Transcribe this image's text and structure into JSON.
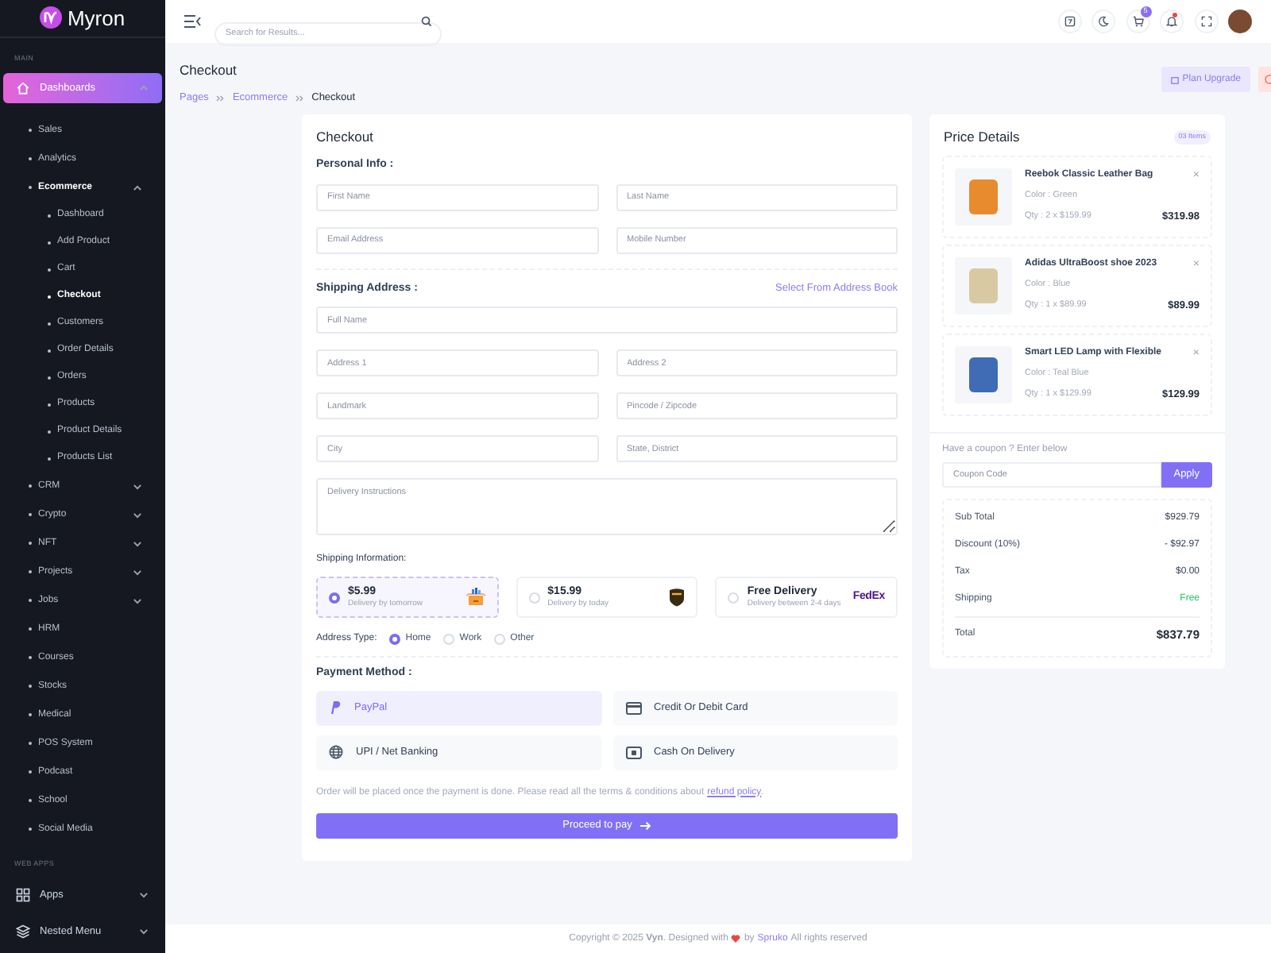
{
  "brand": {
    "name": "Myron"
  },
  "sidebar": {
    "sections": [
      {
        "label": "MAIN",
        "items": [
          {
            "label": "Dashboards",
            "expanded": true,
            "selected": true,
            "children": [
              {
                "label": "Sales",
                "selected": false
              },
              {
                "label": "Analytics",
                "selected": false
              },
              {
                "label": "Ecommerce",
                "selected": false,
                "expanded": true,
                "children": [
                  {
                    "label": "Dashboard",
                    "selected": false
                  },
                  {
                    "label": "Add Product",
                    "selected": false
                  },
                  {
                    "label": "Cart",
                    "selected": false
                  },
                  {
                    "label": "Checkout",
                    "selected": true
                  },
                  {
                    "label": "Customers",
                    "selected": false
                  },
                  {
                    "label": "Order Details",
                    "selected": false
                  },
                  {
                    "label": "Orders",
                    "selected": false
                  },
                  {
                    "label": "Products",
                    "selected": false
                  },
                  {
                    "label": "Product Details",
                    "selected": false
                  },
                  {
                    "label": "Products List",
                    "selected": false
                  }
                ]
              },
              {
                "label": "CRM",
                "selected": false,
                "expanded": false
              },
              {
                "label": "Crypto",
                "selected": false,
                "expanded": false
              },
              {
                "label": "NFT",
                "selected": false,
                "expanded": false
              },
              {
                "label": "Projects",
                "selected": false,
                "expanded": false
              },
              {
                "label": "Jobs",
                "selected": false,
                "expanded": false
              },
              {
                "label": "HRM",
                "selected": false
              },
              {
                "label": "Courses",
                "selected": false
              },
              {
                "label": "Stocks",
                "selected": false
              },
              {
                "label": "Medical",
                "selected": false
              },
              {
                "label": "POS System",
                "selected": false
              },
              {
                "label": "Podcast",
                "selected": false
              },
              {
                "label": "School",
                "selected": false
              },
              {
                "label": "Social Media",
                "selected": false
              }
            ]
          }
        ]
      },
      {
        "label": "WEB APPS",
        "items": [
          {
            "label": "Apps",
            "expanded": false,
            "selected": false
          },
          {
            "label": "Nested Menu",
            "expanded": false,
            "selected": false
          }
        ]
      }
    ]
  },
  "header": {
    "search": {
      "placeholder": "Search for Results..."
    },
    "cart_badge": "5",
    "notifications_unread": true
  },
  "page": {
    "title": "Checkout",
    "breadcrumb": [
      "Pages",
      "Ecommerce",
      "Checkout"
    ],
    "actions": [
      {
        "label": "Plan Upgrade",
        "kind": "upgrade"
      },
      {
        "kind": "danger-icon"
      }
    ]
  },
  "checkout": {
    "title": "Checkout",
    "personal": {
      "heading": "Personal Info :",
      "fields": [
        {
          "placeholder": "First Name"
        },
        {
          "placeholder": "Last Name"
        },
        {
          "placeholder": "Email Address"
        },
        {
          "placeholder": "Mobile Number"
        }
      ]
    },
    "shipping_address": {
      "heading": "Shipping Address :",
      "link": "Select From Address Book",
      "fields": [
        {
          "placeholder": "Full Name",
          "kind": "wide"
        },
        {
          "placeholder": "Address 1",
          "kind": "half"
        },
        {
          "placeholder": "Address 2",
          "kind": "half"
        },
        {
          "placeholder": "Landmark",
          "kind": "half"
        },
        {
          "placeholder": "Pincode / Zipcode",
          "kind": "half"
        },
        {
          "placeholder": "City",
          "kind": "half"
        },
        {
          "placeholder": "State, District",
          "kind": "half"
        },
        {
          "placeholder": "Delivery Instructions",
          "kind": "textarea"
        }
      ]
    },
    "shipping_info": {
      "label": "Shipping Information:",
      "options": [
        {
          "price": "$5.99",
          "note": "Delivery by tomorrow",
          "selected": true
        },
        {
          "price": "$15.99",
          "note": "Delivery by today",
          "selected": false
        },
        {
          "price": "Free Delivery",
          "note": "Delivery between 2-4 days",
          "logo_text": "FedEx",
          "selected": false
        }
      ]
    },
    "address_type": {
      "label": "Address Type:",
      "options": [
        {
          "label": "Home",
          "selected": true
        },
        {
          "label": "Work",
          "selected": false
        },
        {
          "label": "Other",
          "selected": false
        }
      ]
    },
    "payment": {
      "heading": "Payment Method :",
      "methods": [
        {
          "label": "PayPal",
          "selected": true
        },
        {
          "label": "Credit Or Debit Card",
          "selected": false
        },
        {
          "label": "UPI / Net Banking",
          "selected": false
        },
        {
          "label": "Cash On Delivery",
          "selected": false
        }
      ]
    },
    "note": "Order will be placed once the payment is done. Please read all the terms & conditions about",
    "note_link": "refund policy",
    "note_end": ".",
    "submit": "Proceed to pay"
  },
  "price_details": {
    "title": "Price Details",
    "count": "03 Items",
    "items": [
      {
        "name": "Reebok Classic Leather Bag",
        "variant": "Color : Green",
        "qty": "Qty : 2 x $159.99",
        "price": "$319.98",
        "remove": "×"
      },
      {
        "name": "Adidas UltraBoost shoe 2023",
        "variant": "Color : Blue",
        "qty": "Qty : 1 x $89.99",
        "price": "$89.99",
        "remove": "×"
      },
      {
        "name": "Smart LED Lamp with Flexible",
        "variant": "Color : Teal Blue",
        "qty": "Qty : 1 x $129.99",
        "price": "$129.99",
        "remove": "×"
      }
    ],
    "coupon": {
      "label": "Have a coupon ? Enter below",
      "placeholder": "Coupon Code",
      "button": "Apply"
    },
    "summary": [
      {
        "label": "Sub Total",
        "value": "$929.79",
        "kind": "line"
      },
      {
        "label": "Discount (10%)",
        "value": "- $92.97",
        "kind": "line"
      },
      {
        "label": "Tax",
        "value": "$0.00",
        "kind": "line"
      },
      {
        "label": "Shipping",
        "value": "Free",
        "kind": "success"
      },
      {
        "label": "Total",
        "value": "$837.79",
        "kind": "total"
      }
    ]
  },
  "footer": {
    "text": "Copyright © 2025 **Vyn**. Designed with",
    "by": "by",
    "link": "Spruko",
    "end": "All rights reserved"
  }
}
